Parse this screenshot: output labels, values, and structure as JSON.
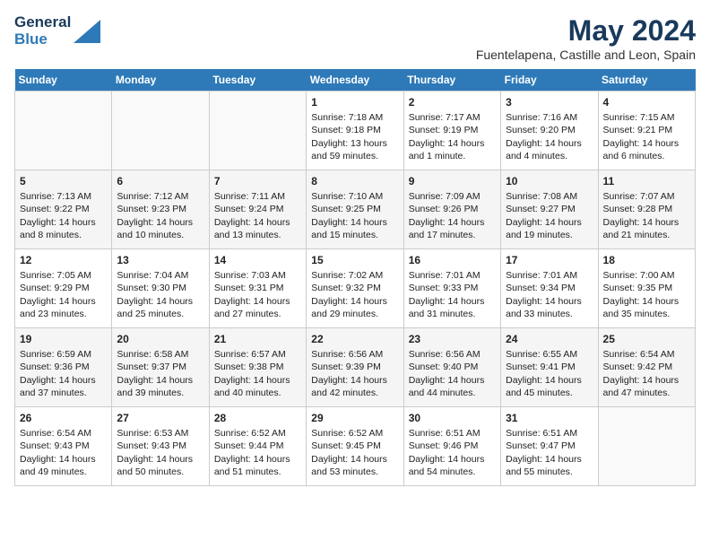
{
  "header": {
    "logo_line1": "General",
    "logo_line2": "Blue",
    "month_title": "May 2024",
    "location": "Fuentelapena, Castille and Leon, Spain"
  },
  "days_of_week": [
    "Sunday",
    "Monday",
    "Tuesday",
    "Wednesday",
    "Thursday",
    "Friday",
    "Saturday"
  ],
  "weeks": [
    [
      {
        "day": "",
        "empty": true
      },
      {
        "day": "",
        "empty": true
      },
      {
        "day": "",
        "empty": true
      },
      {
        "day": "1",
        "sunrise": "Sunrise: 7:18 AM",
        "sunset": "Sunset: 9:18 PM",
        "daylight": "Daylight: 13 hours and 59 minutes."
      },
      {
        "day": "2",
        "sunrise": "Sunrise: 7:17 AM",
        "sunset": "Sunset: 9:19 PM",
        "daylight": "Daylight: 14 hours and 1 minute."
      },
      {
        "day": "3",
        "sunrise": "Sunrise: 7:16 AM",
        "sunset": "Sunset: 9:20 PM",
        "daylight": "Daylight: 14 hours and 4 minutes."
      },
      {
        "day": "4",
        "sunrise": "Sunrise: 7:15 AM",
        "sunset": "Sunset: 9:21 PM",
        "daylight": "Daylight: 14 hours and 6 minutes."
      }
    ],
    [
      {
        "day": "5",
        "sunrise": "Sunrise: 7:13 AM",
        "sunset": "Sunset: 9:22 PM",
        "daylight": "Daylight: 14 hours and 8 minutes."
      },
      {
        "day": "6",
        "sunrise": "Sunrise: 7:12 AM",
        "sunset": "Sunset: 9:23 PM",
        "daylight": "Daylight: 14 hours and 10 minutes."
      },
      {
        "day": "7",
        "sunrise": "Sunrise: 7:11 AM",
        "sunset": "Sunset: 9:24 PM",
        "daylight": "Daylight: 14 hours and 13 minutes."
      },
      {
        "day": "8",
        "sunrise": "Sunrise: 7:10 AM",
        "sunset": "Sunset: 9:25 PM",
        "daylight": "Daylight: 14 hours and 15 minutes."
      },
      {
        "day": "9",
        "sunrise": "Sunrise: 7:09 AM",
        "sunset": "Sunset: 9:26 PM",
        "daylight": "Daylight: 14 hours and 17 minutes."
      },
      {
        "day": "10",
        "sunrise": "Sunrise: 7:08 AM",
        "sunset": "Sunset: 9:27 PM",
        "daylight": "Daylight: 14 hours and 19 minutes."
      },
      {
        "day": "11",
        "sunrise": "Sunrise: 7:07 AM",
        "sunset": "Sunset: 9:28 PM",
        "daylight": "Daylight: 14 hours and 21 minutes."
      }
    ],
    [
      {
        "day": "12",
        "sunrise": "Sunrise: 7:05 AM",
        "sunset": "Sunset: 9:29 PM",
        "daylight": "Daylight: 14 hours and 23 minutes."
      },
      {
        "day": "13",
        "sunrise": "Sunrise: 7:04 AM",
        "sunset": "Sunset: 9:30 PM",
        "daylight": "Daylight: 14 hours and 25 minutes."
      },
      {
        "day": "14",
        "sunrise": "Sunrise: 7:03 AM",
        "sunset": "Sunset: 9:31 PM",
        "daylight": "Daylight: 14 hours and 27 minutes."
      },
      {
        "day": "15",
        "sunrise": "Sunrise: 7:02 AM",
        "sunset": "Sunset: 9:32 PM",
        "daylight": "Daylight: 14 hours and 29 minutes."
      },
      {
        "day": "16",
        "sunrise": "Sunrise: 7:01 AM",
        "sunset": "Sunset: 9:33 PM",
        "daylight": "Daylight: 14 hours and 31 minutes."
      },
      {
        "day": "17",
        "sunrise": "Sunrise: 7:01 AM",
        "sunset": "Sunset: 9:34 PM",
        "daylight": "Daylight: 14 hours and 33 minutes."
      },
      {
        "day": "18",
        "sunrise": "Sunrise: 7:00 AM",
        "sunset": "Sunset: 9:35 PM",
        "daylight": "Daylight: 14 hours and 35 minutes."
      }
    ],
    [
      {
        "day": "19",
        "sunrise": "Sunrise: 6:59 AM",
        "sunset": "Sunset: 9:36 PM",
        "daylight": "Daylight: 14 hours and 37 minutes."
      },
      {
        "day": "20",
        "sunrise": "Sunrise: 6:58 AM",
        "sunset": "Sunset: 9:37 PM",
        "daylight": "Daylight: 14 hours and 39 minutes."
      },
      {
        "day": "21",
        "sunrise": "Sunrise: 6:57 AM",
        "sunset": "Sunset: 9:38 PM",
        "daylight": "Daylight: 14 hours and 40 minutes."
      },
      {
        "day": "22",
        "sunrise": "Sunrise: 6:56 AM",
        "sunset": "Sunset: 9:39 PM",
        "daylight": "Daylight: 14 hours and 42 minutes."
      },
      {
        "day": "23",
        "sunrise": "Sunrise: 6:56 AM",
        "sunset": "Sunset: 9:40 PM",
        "daylight": "Daylight: 14 hours and 44 minutes."
      },
      {
        "day": "24",
        "sunrise": "Sunrise: 6:55 AM",
        "sunset": "Sunset: 9:41 PM",
        "daylight": "Daylight: 14 hours and 45 minutes."
      },
      {
        "day": "25",
        "sunrise": "Sunrise: 6:54 AM",
        "sunset": "Sunset: 9:42 PM",
        "daylight": "Daylight: 14 hours and 47 minutes."
      }
    ],
    [
      {
        "day": "26",
        "sunrise": "Sunrise: 6:54 AM",
        "sunset": "Sunset: 9:43 PM",
        "daylight": "Daylight: 14 hours and 49 minutes."
      },
      {
        "day": "27",
        "sunrise": "Sunrise: 6:53 AM",
        "sunset": "Sunset: 9:43 PM",
        "daylight": "Daylight: 14 hours and 50 minutes."
      },
      {
        "day": "28",
        "sunrise": "Sunrise: 6:52 AM",
        "sunset": "Sunset: 9:44 PM",
        "daylight": "Daylight: 14 hours and 51 minutes."
      },
      {
        "day": "29",
        "sunrise": "Sunrise: 6:52 AM",
        "sunset": "Sunset: 9:45 PM",
        "daylight": "Daylight: 14 hours and 53 minutes."
      },
      {
        "day": "30",
        "sunrise": "Sunrise: 6:51 AM",
        "sunset": "Sunset: 9:46 PM",
        "daylight": "Daylight: 14 hours and 54 minutes."
      },
      {
        "day": "31",
        "sunrise": "Sunrise: 6:51 AM",
        "sunset": "Sunset: 9:47 PM",
        "daylight": "Daylight: 14 hours and 55 minutes."
      },
      {
        "day": "",
        "empty": true
      }
    ]
  ]
}
